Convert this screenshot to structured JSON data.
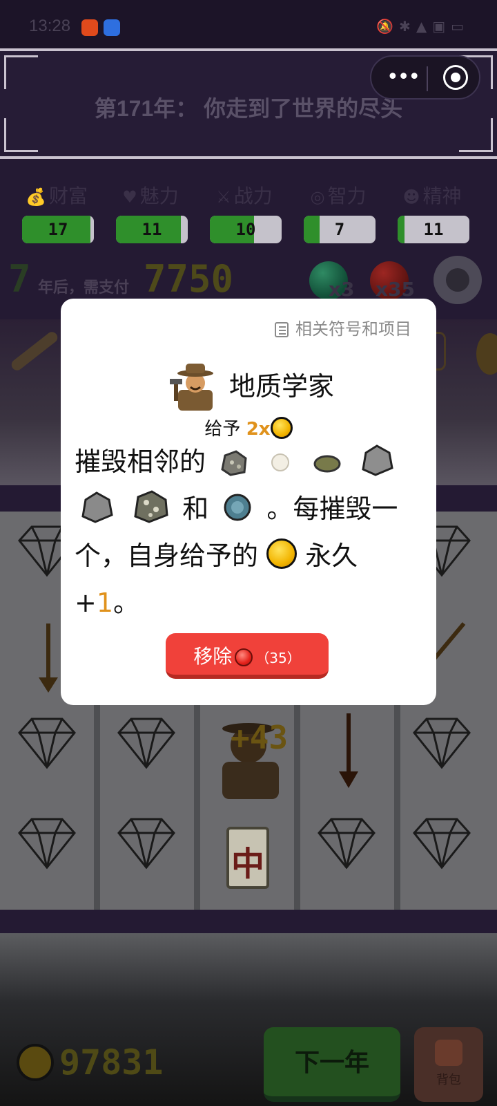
{
  "status_bar": {
    "time": "13:28"
  },
  "header": {
    "title": "第171年： 你走到了世界的尽头"
  },
  "stats": [
    {
      "icon": "money-bag-icon",
      "glyph": "💰",
      "label": "财富",
      "value": "17",
      "fill": 0.95
    },
    {
      "icon": "heart-icon",
      "glyph": "♥",
      "label": "魅力",
      "value": "11",
      "fill": 0.9
    },
    {
      "icon": "sword-icon",
      "glyph": "⚔",
      "label": "战力",
      "value": "10",
      "fill": 0.62
    },
    {
      "icon": "brain-icon",
      "glyph": "◎",
      "label": "智力",
      "value": "7",
      "fill": 0.22
    },
    {
      "icon": "mask-icon",
      "glyph": "☻",
      "label": "精神",
      "value": "11",
      "fill": 0.1
    }
  ],
  "payment": {
    "years": "7",
    "years_text": "年后，需支付",
    "amount": "7750"
  },
  "resources": {
    "green_orb_count": "x3",
    "red_orb_count": "x35"
  },
  "modal": {
    "related_label": "相关符号和项目",
    "name": "地质学家",
    "gives_prefix": "给予",
    "gives_mult": "2x",
    "desc_1": "摧毁相邻的",
    "desc_and": "和",
    "desc_2": "。每摧毁一个，自身给予的",
    "desc_3": "永久",
    "desc_plus": "+",
    "desc_num": "1",
    "desc_end": "。",
    "remove_label": "移除",
    "remove_count": "（35）"
  },
  "board": {
    "floating_bonus": "+43",
    "mahjong_char": "中"
  },
  "bottom": {
    "money": "97831",
    "next_year_label": "下一年",
    "bag_label": "背包"
  }
}
